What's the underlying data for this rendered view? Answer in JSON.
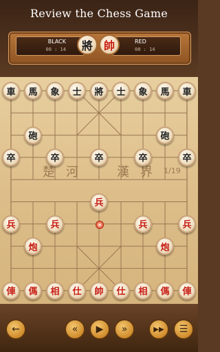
{
  "header": {
    "title": "Review the Chess Game"
  },
  "players": {
    "black": {
      "name": "BLACK",
      "time": "00 : 14",
      "avatar": "將"
    },
    "red": {
      "name": "RED",
      "time": "00 : 14",
      "avatar": "帥"
    }
  },
  "board": {
    "river_left_1": "楚",
    "river_left_2": "河",
    "river_right_1": "漢",
    "river_right_2": "界",
    "move_counter": "1/19",
    "pieces": [
      {
        "char": "車",
        "side": "black",
        "col": 0,
        "row": 0
      },
      {
        "char": "馬",
        "side": "black",
        "col": 1,
        "row": 0
      },
      {
        "char": "象",
        "side": "black",
        "col": 2,
        "row": 0
      },
      {
        "char": "士",
        "side": "black",
        "col": 3,
        "row": 0
      },
      {
        "char": "將",
        "side": "black",
        "col": 4,
        "row": 0
      },
      {
        "char": "士",
        "side": "black",
        "col": 5,
        "row": 0
      },
      {
        "char": "象",
        "side": "black",
        "col": 6,
        "row": 0
      },
      {
        "char": "馬",
        "side": "black",
        "col": 7,
        "row": 0
      },
      {
        "char": "車",
        "side": "black",
        "col": 8,
        "row": 0
      },
      {
        "char": "砲",
        "side": "black",
        "col": 1,
        "row": 2
      },
      {
        "char": "砲",
        "side": "black",
        "col": 7,
        "row": 2
      },
      {
        "char": "卒",
        "side": "black",
        "col": 0,
        "row": 3
      },
      {
        "char": "卒",
        "side": "black",
        "col": 2,
        "row": 3
      },
      {
        "char": "卒",
        "side": "black",
        "col": 4,
        "row": 3
      },
      {
        "char": "卒",
        "side": "black",
        "col": 6,
        "row": 3
      },
      {
        "char": "卒",
        "side": "black",
        "col": 8,
        "row": 3
      },
      {
        "char": "兵",
        "side": "red",
        "col": 4,
        "row": 5
      },
      {
        "char": "兵",
        "side": "red",
        "col": 0,
        "row": 6
      },
      {
        "char": "兵",
        "side": "red",
        "col": 2,
        "row": 6
      },
      {
        "char": "兵",
        "side": "red",
        "col": 6,
        "row": 6
      },
      {
        "char": "兵",
        "side": "red",
        "col": 8,
        "row": 6
      },
      {
        "char": "炮",
        "side": "red",
        "col": 1,
        "row": 7
      },
      {
        "char": "炮",
        "side": "red",
        "col": 7,
        "row": 7
      },
      {
        "char": "俥",
        "side": "red",
        "col": 0,
        "row": 9
      },
      {
        "char": "傌",
        "side": "red",
        "col": 1,
        "row": 9
      },
      {
        "char": "相",
        "side": "red",
        "col": 2,
        "row": 9
      },
      {
        "char": "仕",
        "side": "red",
        "col": 3,
        "row": 9
      },
      {
        "char": "帥",
        "side": "red",
        "col": 4,
        "row": 9
      },
      {
        "char": "仕",
        "side": "red",
        "col": 5,
        "row": 9
      },
      {
        "char": "相",
        "side": "red",
        "col": 6,
        "row": 9
      },
      {
        "char": "傌",
        "side": "red",
        "col": 7,
        "row": 9
      },
      {
        "char": "俥",
        "side": "red",
        "col": 8,
        "row": 9
      }
    ],
    "last_move_marker": {
      "col": 4,
      "row": 6
    }
  },
  "controls": {
    "back": "arrow-left-icon",
    "prev": "chevron-double-left-icon",
    "play": "play-icon",
    "next": "chevron-double-right-icon",
    "fast_forward": "fast-forward-icon",
    "menu": "menu-icon"
  },
  "colors": {
    "red_piece": "#c61c12",
    "black_piece": "#222222",
    "button_gold": "#d08c2c"
  }
}
